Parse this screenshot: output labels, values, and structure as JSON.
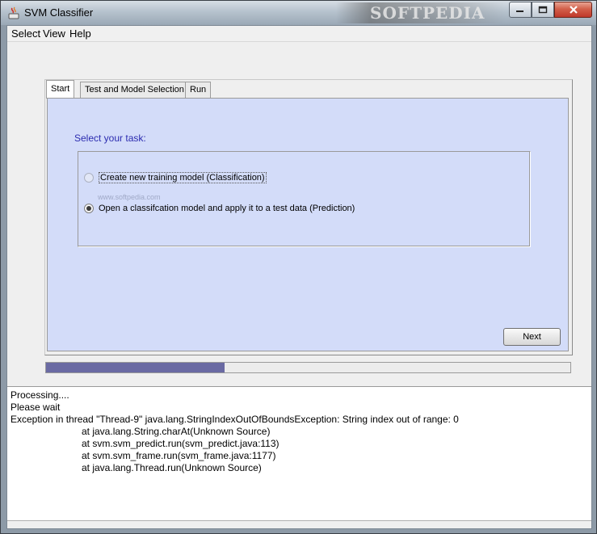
{
  "window": {
    "title": "SVM Classifier",
    "watermark": "SOFTPEDIA",
    "controls": {
      "minimize": "—",
      "maximize": "☐",
      "close": "✕"
    }
  },
  "menu": [
    "Select",
    "View",
    "Help"
  ],
  "tabs": [
    "Start",
    "Test and Model Selection",
    "Run"
  ],
  "start_panel": {
    "prompt": "Select your task:",
    "options": [
      {
        "label": "Create new training model (Classification)",
        "selected": false
      },
      {
        "label": "Open a classifcation model and apply it to a test data (Prediction)",
        "selected": true
      }
    ],
    "watermark": "www.softpedia.com",
    "next_button": "Next"
  },
  "progress": {
    "fraction": 0.34
  },
  "console": [
    "Processing....",
    "Please wait",
    "Exception in thread \"Thread-9\" java.lang.StringIndexOutOfBoundsException: String index out of range: 0",
    "at java.lang.String.charAt(Unknown Source)",
    "at svm.svm_predict.run(svm_predict.java:113)",
    "at svm.svm_frame.run(svm_frame.java:1177)",
    "at java.lang.Thread.run(Unknown Source)"
  ],
  "colors": {
    "panel": "#d3dcf9",
    "prompt_text": "#2c2cb0",
    "progress_fill": "#6a6aa3"
  }
}
